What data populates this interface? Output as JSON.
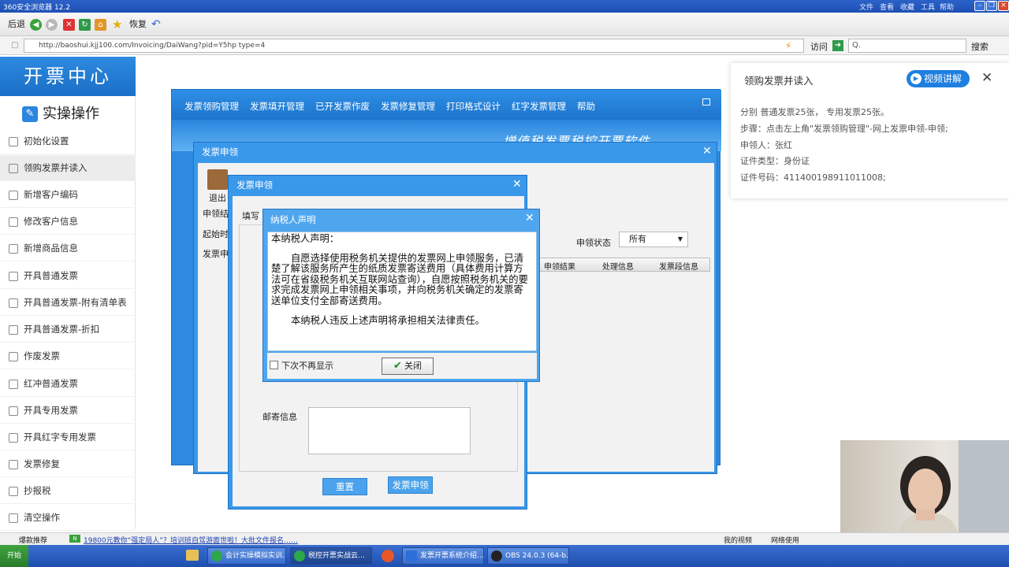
{
  "browser": {
    "title": "360安全浏览器 12.2",
    "menu": [
      "文件",
      "查看",
      "收藏",
      "工具",
      "帮助"
    ],
    "nav": {
      "back": "后退",
      "restore": "恢复"
    },
    "url": "http://baoshui.kjj100.com/Invoicing/DaiWang?pid=Y5hp type=4",
    "visit": "访问",
    "search_btn": "搜索",
    "search_value": "Q."
  },
  "sidebar": {
    "brand": "开票中心",
    "section": "实操操作",
    "items": [
      {
        "label": "初始化设置"
      },
      {
        "label": "领购发票并读入"
      },
      {
        "label": "新增客户编码"
      },
      {
        "label": "修改客户信息"
      },
      {
        "label": "新增商品信息"
      },
      {
        "label": "开具普通发票"
      },
      {
        "label": "开具普通发票-附有清单表"
      },
      {
        "label": "开具普通发票-折扣"
      },
      {
        "label": "作废发票"
      },
      {
        "label": "红冲普通发票"
      },
      {
        "label": "开具专用发票"
      },
      {
        "label": "开具红字专用发票"
      },
      {
        "label": "发票修复"
      },
      {
        "label": "抄报税"
      },
      {
        "label": "清空操作"
      }
    ]
  },
  "app": {
    "menu": [
      "发票领购管理",
      "发票填开管理",
      "已开发票作废",
      "发票修复管理",
      "打印格式设计",
      "红字发票管理",
      "帮助"
    ],
    "banner": "增值税发票税控开票软件"
  },
  "dialog_apply": {
    "title": "发票申领",
    "exit": "退出",
    "left_labels": [
      "申领结",
      "起始时",
      "发票申"
    ],
    "filter_label": "申领状态",
    "filter_value": "所有",
    "columns": [
      "申领结果",
      "处理信息",
      "发票段信息"
    ]
  },
  "dialog_form": {
    "title": "发票申领",
    "fill_label": "填写",
    "mail_label": "邮寄信息",
    "reset": "重置",
    "submit": "发票申领"
  },
  "dialog_statement": {
    "title": "纳税人声明",
    "heading": "本纳税人声明：",
    "para1": "自愿选择使用税务机关提供的发票网上申领服务，已清楚了解该服务所产生的纸质发票寄送费用（具体费用计算方法可在省级税务机关互联网站查询），自愿按照税务机关的要求完成发票网上申领相关事项，并向税务机关确定的发票寄送单位支付全部寄送费用。",
    "para2": "本纳税人违反上述声明将承担相关法律责任。",
    "checkbox_label": "下次不再显示",
    "close": "关闭"
  },
  "panel": {
    "title": "领购发票并读入",
    "video_btn": "视频讲解",
    "lines": [
      "分别 普通发票25张， 专用发票25张。",
      "步骤：点击左上角\"发票领购管理\"-网上发票申领-申领;",
      "申领人：张红",
      "证件类型：身份证",
      "证件号码：411400198911011008;"
    ]
  },
  "statusbar": {
    "left": "爆款推荐",
    "news": "19800元教你“强定局人”？培训班自驾游面世啦！大批文件报名……",
    "right": [
      "我的视频",
      "网络使用"
    ]
  },
  "taskbar": {
    "start": "开始",
    "tasks": [
      "会计实操模拟实训…",
      "税控开票实战云…",
      "发票开票系统介绍…",
      "OBS 24.0.3 (64-b…"
    ]
  },
  "colors": {
    "brand": "#1b6fc6",
    "accent": "#2d8ae0",
    "video_btn": "#1e7fe0"
  }
}
